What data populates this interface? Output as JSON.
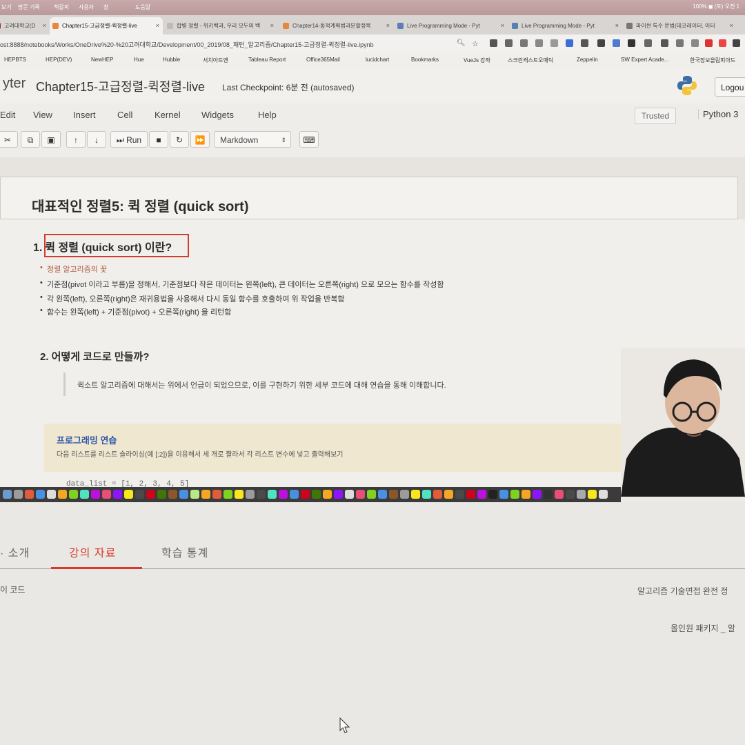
{
  "system": {
    "menu_items": [
      "보기",
      "방문 기록",
      "책갈피",
      "사용자",
      "창",
      "도움말"
    ],
    "status_right": "100% ◼ (토) 오전 1"
  },
  "tabs": [
    {
      "label": "고려대학교(D",
      "active": false
    },
    {
      "label": "Chapter15-고급정렬-퀵정렬-live",
      "active": true
    },
    {
      "label": "합병 정렬 - 위키백과, 우리 모두의 백",
      "active": false
    },
    {
      "label": "Chapter14-동적계획법과분할정복",
      "active": false
    },
    {
      "label": "Live Programming Mode - Pyt",
      "active": false
    },
    {
      "label": "Live Programming Mode - Pyt",
      "active": false
    },
    {
      "label": "파이썬 특수 문법(데코레이터, 이터",
      "active": false
    }
  ],
  "url": "ost:8888/notebooks/Works/OneDrive%20-%20고려대학교/Development/00_2019/08_패턴_알고리즘/Chapter15-고급정렬-퀵정렬-live.ipynb",
  "bookmarks": [
    "HEPBTS",
    "HEP(DEV)",
    "NewHEP",
    "Hue",
    "Hubble",
    "서치아트앤",
    "Tableau Report",
    "Office365Mail",
    "lucidchart",
    "Bookmarks",
    "VueJs 강좌",
    "스크린캐스트오매틱",
    "Zeppelin",
    "SW Expert Acade...",
    "한국정보올림피아드"
  ],
  "jupyter": {
    "logo": "yter",
    "notebook_title": "Chapter15-고급정렬-퀵정렬-live",
    "checkpoint": "Last Checkpoint: 6분 전  (autosaved)",
    "logout": "Logou",
    "menu": [
      "Edit",
      "View",
      "Insert",
      "Cell",
      "Kernel",
      "Widgets",
      "Help"
    ],
    "trusted": "Trusted",
    "kernel": "Python 3",
    "run_label": "Run",
    "cell_type": "Markdown"
  },
  "notebook": {
    "h1": "대표적인 정렬5: 퀵 정렬 (quick sort)",
    "section1_num": "1.",
    "section1_title": "퀵 정렬 (quick sort) 이란?",
    "bullets": [
      "정렬 알고리즘의 꽃",
      "기준점(pivot 이라고 부름)을 정해서, 기준점보다 작은 데이터는 왼쪽(left), 큰 데이터는 오른쪽(right) 으로 모으는 함수를 작성함",
      "각 왼쪽(left), 오른쪽(right)은 재귀용법을 사용해서 다시 동일 함수를 호출하여 위 작업을 반복함",
      "함수는 왼쪽(left) + 기준점(pivot) + 오른쪽(right) 을 리턴함"
    ],
    "section2_title": "2. 어떻게 코드로 만들까?",
    "quote": "퀵소트 알고리즘에 대해서는 위에서 언급이 되었으므로, 이를 구현하기 위한 세부 코드에 대해 연습을 통해 이해합니다.",
    "practice_title": "프로그래밍 연습",
    "practice_desc": "다음 리스트를 리스트 슬라이싱(예 [:2])을 이용해서 세 개로 짤라서 각 리스트 변수에 넣고 출력해보기",
    "code_peek": "data_list = [1, 2, 3, 4, 5]"
  },
  "course_page": {
    "tabs": [
      "소개",
      "강의 자료",
      "학습 통계"
    ],
    "active_tab": "강의 자료",
    "left_text": "이 코드",
    "right_text_1": "알고리즘 기술면접 완전 정",
    "right_text_2": "올인원 패키지 _ 알"
  },
  "colors": {
    "accent_red": "#d8382b",
    "practice_bg": "#efe7cf",
    "practice_title": "#2e56a8"
  }
}
